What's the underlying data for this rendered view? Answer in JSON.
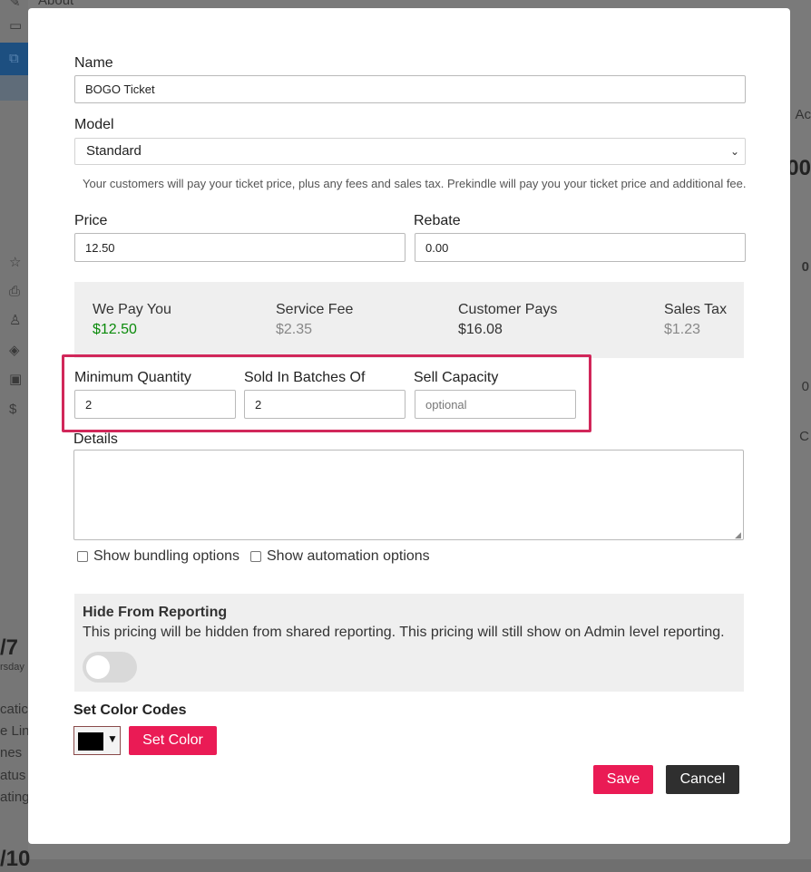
{
  "background": {
    "top_label": "About",
    "left_fragments": [
      "/7",
      "rsday",
      "catic",
      "e Lin",
      "nes",
      "atus",
      "ating",
      "/10"
    ],
    "right_fragments": [
      "Ac",
      "00",
      "0",
      "0",
      "C"
    ]
  },
  "form": {
    "name": {
      "label": "Name",
      "value": "BOGO Ticket"
    },
    "model": {
      "label": "Model",
      "selected": "Standard",
      "helper": "Your customers will pay your ticket price, plus any fees and sales tax. Prekindle will pay you your ticket price and additional fee."
    },
    "price": {
      "label": "Price",
      "value": "12.50"
    },
    "rebate": {
      "label": "Rebate",
      "value": "0.00"
    },
    "summary": [
      {
        "label": "We Pay You",
        "value": "$12.50",
        "color": "#0a8a0a"
      },
      {
        "label": "Service Fee",
        "value": "$2.35",
        "color": "#888888"
      },
      {
        "label": "Customer Pays",
        "value": "$16.08",
        "color": "#333333"
      },
      {
        "label": "Sales Tax",
        "value": "$1.23",
        "color": "#888888"
      }
    ],
    "min_quantity": {
      "label": "Minimum Quantity",
      "value": "2"
    },
    "batches": {
      "label": "Sold In Batches Of",
      "value": "2"
    },
    "capacity": {
      "label": "Sell Capacity",
      "placeholder": "optional"
    },
    "details": {
      "label": "Details"
    },
    "bundling_option": "Show bundling options",
    "automation_option": "Show automation options",
    "hide_reporting": {
      "title": "Hide From Reporting",
      "description": "This pricing will be hidden from shared reporting. This pricing will still show on Admin level reporting.",
      "enabled": false
    },
    "color_codes": {
      "title": "Set Color Codes",
      "current_color": "#000000",
      "button": "Set Color"
    },
    "save_label": "Save",
    "cancel_label": "Cancel"
  },
  "colors": {
    "accent": "#ea1b55",
    "highlight": "#d1275a",
    "dark_button": "#2f2f2f"
  }
}
